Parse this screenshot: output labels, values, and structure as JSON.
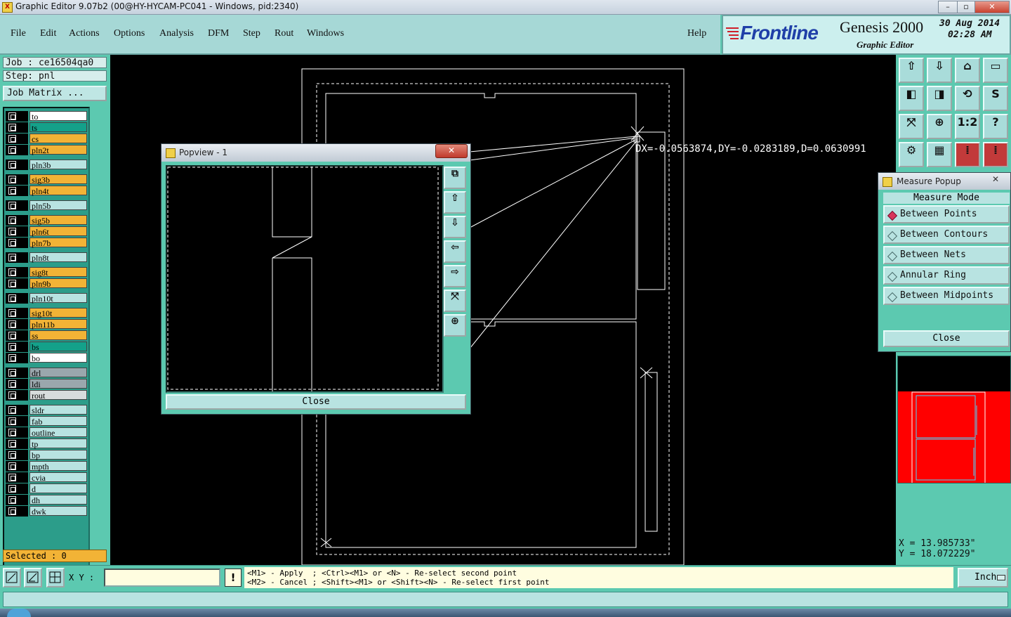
{
  "window": {
    "title": "Graphic Editor 9.07b2 (00@HY-HYCAM-PC041 - Windows, pid:2340)",
    "min": "–",
    "max": "▫",
    "close": "✕"
  },
  "menu": {
    "items": [
      "File",
      "Edit",
      "Actions",
      "Options",
      "Analysis",
      "DFM",
      "Step",
      "Rout",
      "Windows"
    ],
    "help": "Help"
  },
  "brand": {
    "logo": "Frontline",
    "product": "Genesis 2000",
    "subtitle": "Graphic Editor",
    "date": "30 Aug 2014",
    "time": "02:28 AM"
  },
  "job": {
    "job_label": "Job : ce16504qa0",
    "step_label": "Step: pnl",
    "matrix_button": "Job Matrix ..."
  },
  "layers": [
    {
      "name": "to",
      "color": "#ffffff"
    },
    {
      "name": "ts",
      "color": "#14a18a"
    },
    {
      "name": "cs",
      "color": "#f2b336"
    },
    {
      "name": "pln2t",
      "color": "#f2b336"
    },
    {
      "name": "pln3b",
      "color": "#b8e3e1"
    },
    {
      "name": "sig3b",
      "color": "#f2b336"
    },
    {
      "name": "pln4t",
      "color": "#f2b336"
    },
    {
      "name": "pln5b",
      "color": "#b8e3e1"
    },
    {
      "name": "sig5b",
      "color": "#f2b336"
    },
    {
      "name": "pln6t",
      "color": "#f2b336"
    },
    {
      "name": "pln7b",
      "color": "#f2b336"
    },
    {
      "name": "pln8t",
      "color": "#b8e3e1"
    },
    {
      "name": "sig8t",
      "color": "#f2b336"
    },
    {
      "name": "pln9b",
      "color": "#f2b336"
    },
    {
      "name": "pln10t",
      "color": "#b8e3e1"
    },
    {
      "name": "sig10t",
      "color": "#f2b336"
    },
    {
      "name": "pln11b",
      "color": "#f2b336"
    },
    {
      "name": "ss",
      "color": "#f2b336"
    },
    {
      "name": "bs",
      "color": "#14a18a"
    },
    {
      "name": "bo",
      "color": "#ffffff"
    },
    {
      "name": "drl",
      "color": "#9aa7ad"
    },
    {
      "name": "ldi",
      "color": "#9aa7ad"
    },
    {
      "name": "rout",
      "color": "#d7dcdc"
    },
    {
      "name": "sldr",
      "color": "#b8e3e1"
    },
    {
      "name": "fab",
      "color": "#b8e3e1"
    },
    {
      "name": "outline",
      "color": "#b8e3e1"
    },
    {
      "name": "tp",
      "color": "#b8e3e1"
    },
    {
      "name": "bp",
      "color": "#b8e3e1"
    },
    {
      "name": "mpth",
      "color": "#b8e3e1"
    },
    {
      "name": "cvia",
      "color": "#b8e3e1"
    },
    {
      "name": "d",
      "color": "#b8e3e1"
    },
    {
      "name": "dh",
      "color": "#b8e3e1"
    },
    {
      "name": "dwk",
      "color": "#b8e3e1"
    }
  ],
  "selected": "Selected : 0",
  "measure_readout": "DX=-0.0563874,DY=-0.0283189,D=0.0630991",
  "popview": {
    "title": "Popview - 1",
    "close_label": "Close",
    "close_x": "✕"
  },
  "measure_popup": {
    "title": "Measure Popup",
    "mode_label": "Measure Mode",
    "options": [
      {
        "label": "Between Points",
        "selected": true
      },
      {
        "label": "Between Contours",
        "selected": false
      },
      {
        "label": "Between Nets",
        "selected": false
      },
      {
        "label": "Annular Ring",
        "selected": false
      },
      {
        "label": "Between Midpoints",
        "selected": false
      }
    ],
    "close_label": "Close",
    "close_x": "✕"
  },
  "coords": {
    "x": "X = 13.985733\"",
    "y": "Y = 18.072229\""
  },
  "bottom": {
    "xy_label": "X Y :",
    "xy_value": "",
    "hint_line1": "<M1> - Apply  ; <Ctrl><M1> or <N> - Re-select second point",
    "hint_line2": "<M2> - Cancel ; <Shift><M1> or <Shift><N> - Re-select first point",
    "units": "Inch",
    "warn_icon": "!"
  },
  "status_text": "",
  "colors": {
    "background": "#5cc9b0",
    "canvas": "#000000",
    "minimap_fill": "#ff0000",
    "accent": "#d8355b"
  }
}
